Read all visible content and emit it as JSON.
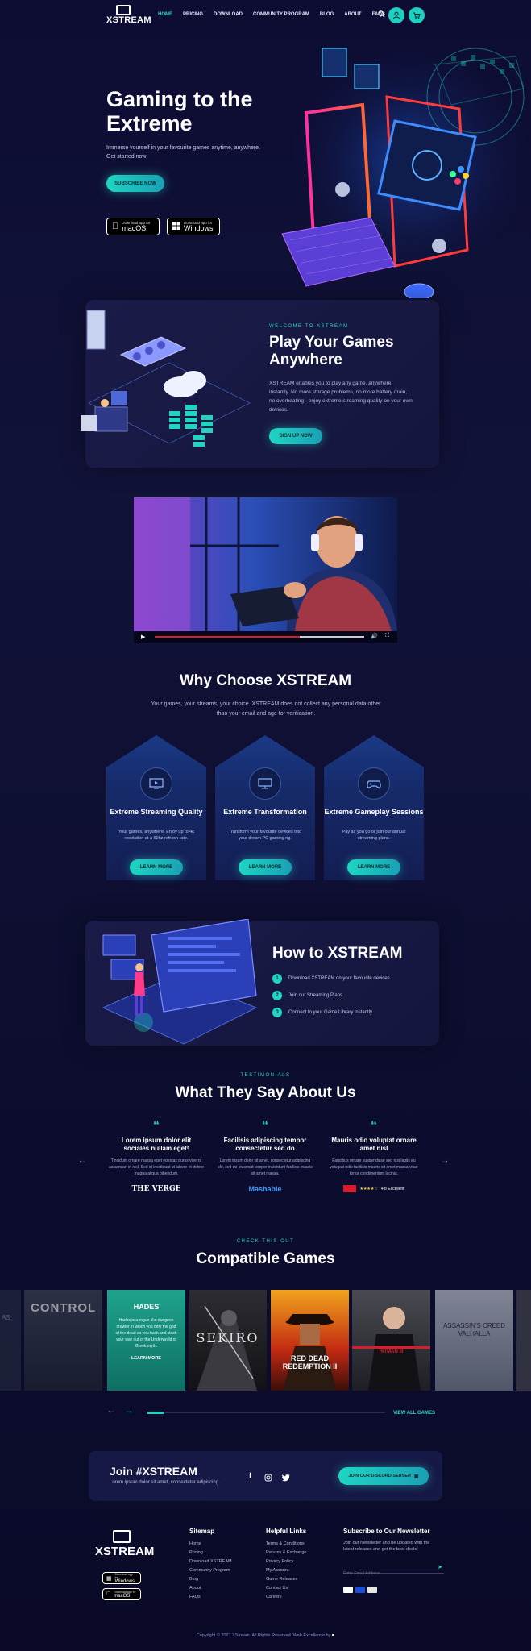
{
  "brand": {
    "name": "XSTREAM",
    "accent": "#1fd5c2"
  },
  "nav": {
    "items": [
      "HOME",
      "PRICING",
      "DOWNLOAD",
      "COMMUNITY PROGRAM",
      "BLOG",
      "ABOUT",
      "FAQS"
    ],
    "search_icon": "search-icon",
    "user_icon": "user-icon",
    "cart_icon": "cart-icon"
  },
  "hero": {
    "title": "Gaming to the Extreme",
    "subtitle": "Immerse yourself in your favourite games anytime, anywhere. Get started now!",
    "cta": "SUBSCRIBE NOW",
    "mac": {
      "small": "Download app for",
      "big": "macOS"
    },
    "win": {
      "small": "Download app for",
      "big": "Windows"
    }
  },
  "welcome": {
    "kicker": "WELCOME TO XSTREAM",
    "title": "Play Your Games Anywhere",
    "text": "XSTREAM enables you to play any game, anywhere, instantly. No more storage problems, no more battery drain, no overheating - enjoy extreme streaming quality on your own devices.",
    "cta": "SIGN UP NOW"
  },
  "why": {
    "title": "Why Choose XSTREAM",
    "subtitle": "Your games, your streams, your choice. XSTREAM does not collect any personal data other than your email and age for verification.",
    "features": [
      {
        "title": "Extreme Streaming Quality",
        "text": "Your games, anywhere. Enjoy up to 4k resolution at a 60hz refresh rate.",
        "cta": "LEARN MORE",
        "icon": "play-screen-icon"
      },
      {
        "title": "Extreme Transformation",
        "text": "Transform your favourite devices into your dream PC gaming rig.",
        "cta": "LEARN MORE",
        "icon": "monitor-icon"
      },
      {
        "title": "Extreme Gameplay Sessions",
        "text": "Pay as you go or join our annual streaming plans.",
        "cta": "LEARN MORE",
        "icon": "gamepad-icon"
      }
    ]
  },
  "how": {
    "title": "How to XSTREAM",
    "steps": [
      {
        "num": "1",
        "text": "Download XSTREAM on your favourite devices"
      },
      {
        "num": "2",
        "text": "Join our Streaming Plans"
      },
      {
        "num": "3",
        "text": "Connect to your Game Library instantly"
      }
    ]
  },
  "testimonials": {
    "kicker": "TESTIMONIALS",
    "title": "What They Say About Us",
    "items": [
      {
        "title": "Lorem ipsum dolor elit sociales nullam eget!",
        "text": "Tincidunt ornare massa eget egestas purus viverra accumsan in nisl. Sed id incididunt ut labore et dolore magna aliqua bibendum.",
        "source": "THE VERGE"
      },
      {
        "title": "Facilisis adipiscing tempor consectetur sed do",
        "text": "Lorem ipsum dolor sit amet, consectetur adipiscing elit, sed do eiusmod tempor incididunt facilisis mauris sit amet massa.",
        "source": "Mashable"
      },
      {
        "title": "Mauris odio voluptat ornare amet nisl",
        "text": "Faucibus ornare suspendisse sed nisi lagiis eu volutpat odio facilisis mauris sit amet massa vitae tortor condimentum lacinia.",
        "source": "4.8 Excellent"
      }
    ]
  },
  "games": {
    "kicker": "CHECK THIS OUT",
    "title": "Compatible Games",
    "featured": {
      "title": "HADES",
      "text": "Hades is a rogue-like dungeon crawler in which you defy the god of the dead as you hack and slash your way out of the Underworld of Greek myth.",
      "cta": "LEARN MORE"
    },
    "tiles": [
      "CONTROL",
      "SEKIRO",
      "RED DEAD REDEMPTION II",
      "HITMAN III",
      "ASSASSIN'S CREED VALHALLA"
    ],
    "view_all": "VIEW ALL GAMES"
  },
  "discord": {
    "title": "Join #XSTREAM",
    "subtitle": "Lorem ipsum dolor sit amet, consectetur adipiscing.",
    "cta": "JOIN OUR DISCORD SERVER"
  },
  "footer": {
    "sitemap_title": "Sitemap",
    "sitemap": [
      "Home",
      "Pricing",
      "Download XSTREAM",
      "Community Program",
      "Blog",
      "About",
      "FAQs"
    ],
    "help_title": "Helpful Links",
    "help": [
      "Terms & Conditions",
      "Returns & Exchange",
      "Privacy Policy",
      "My Account",
      "Game Releases",
      "Contact Us",
      "Careers"
    ],
    "newsletter_title": "Subscribe to Our Newsletter",
    "newsletter_text": "Join our Newsletter and be updated with the latest releases and get the best deals!",
    "email_placeholder": "Enter Email Address",
    "win": {
      "small": "Download app for",
      "big": "Windows"
    },
    "mac": {
      "small": "Download app for",
      "big": "macOS"
    },
    "copyright": "Copyright © 2021 XStream. All Rights Reserved. Web Excellence by"
  }
}
